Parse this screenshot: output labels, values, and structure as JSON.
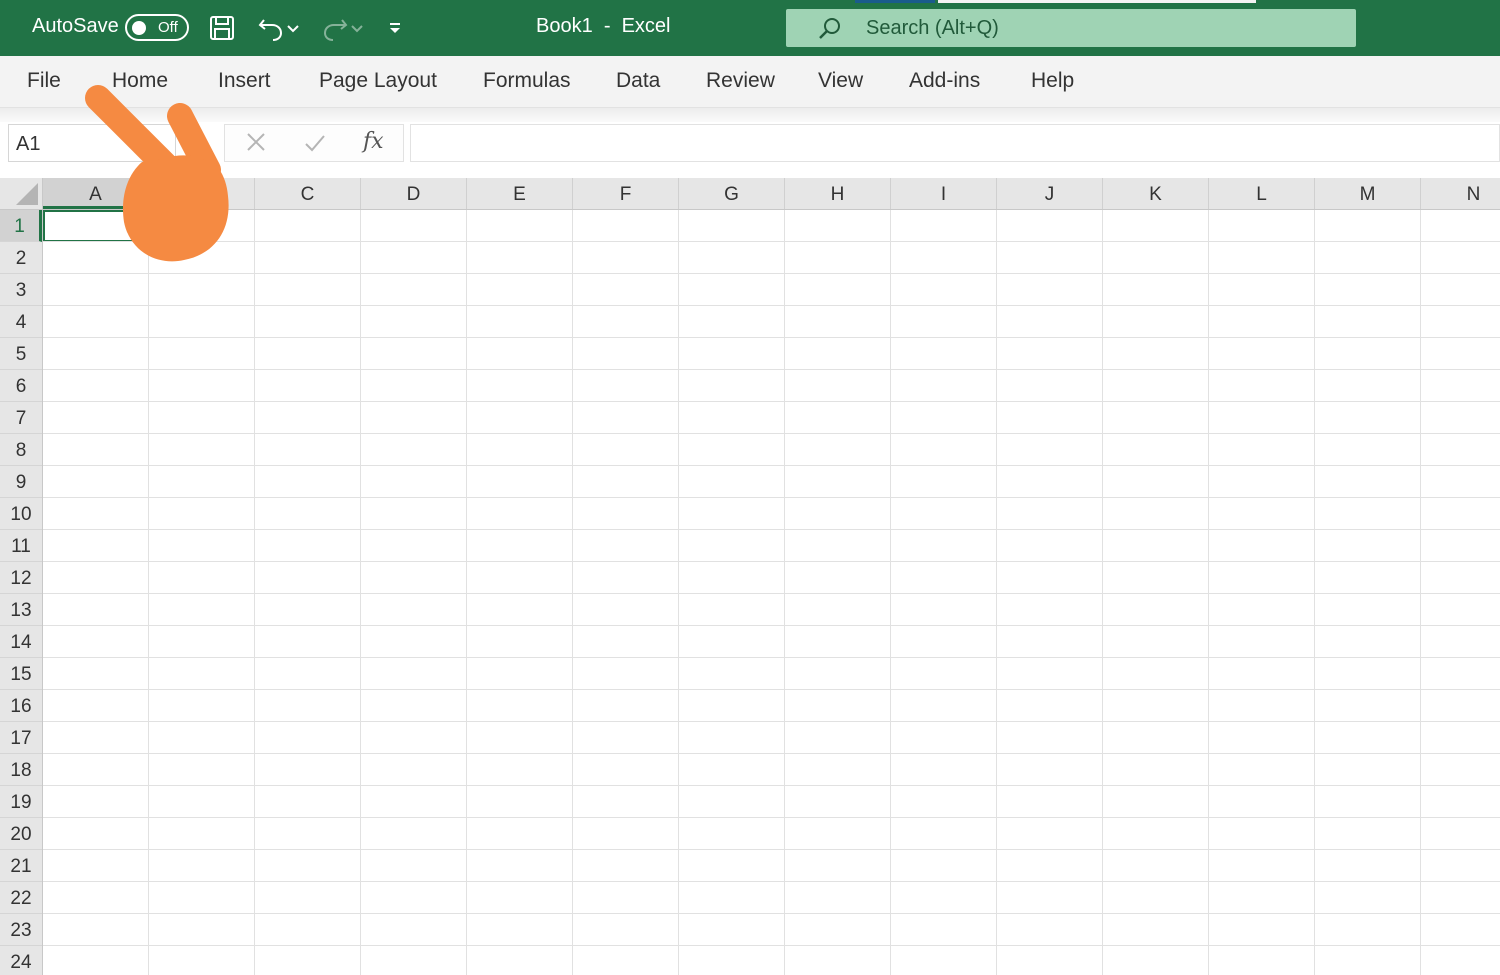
{
  "titlebar": {
    "autosave_label": "AutoSave",
    "autosave_state": "Off",
    "document_title": "Book1  -  Excel",
    "search_placeholder": "Search (Alt+Q)",
    "background_color": "#217346"
  },
  "ribbon": {
    "tabs": [
      {
        "label": "File"
      },
      {
        "label": "Home"
      },
      {
        "label": "Insert"
      },
      {
        "label": "Page Layout"
      },
      {
        "label": "Formulas"
      },
      {
        "label": "Data"
      },
      {
        "label": "Review"
      },
      {
        "label": "View"
      },
      {
        "label": "Add-ins"
      },
      {
        "label": "Help"
      }
    ]
  },
  "formula_bar": {
    "name_box": "A1",
    "fx_label": "fx",
    "formula_value": ""
  },
  "grid": {
    "columns": [
      "A",
      "B",
      "C",
      "D",
      "E",
      "F",
      "G",
      "H",
      "I",
      "J",
      "K",
      "L",
      "M",
      "N"
    ],
    "rows": [
      "1",
      "2",
      "3",
      "4",
      "5",
      "6",
      "7",
      "8",
      "9",
      "10",
      "11",
      "12",
      "13",
      "14",
      "15",
      "16",
      "17",
      "18",
      "19",
      "20",
      "21",
      "22",
      "23",
      "24"
    ],
    "active_cell": "A1",
    "accent_color": "#217346"
  },
  "overlay": {
    "pointer_color": "#f58a42",
    "pointer_icon": "pointing-hand-icon"
  }
}
